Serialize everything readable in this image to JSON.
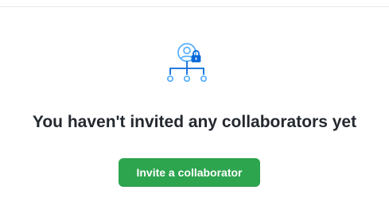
{
  "blankslate": {
    "heading": "You haven't invited any collaborators yet",
    "cta_label": "Invite a collaborator",
    "icon": "person-lock-network-icon"
  },
  "colors": {
    "accent_blue": "#54aeff",
    "accent_blue_dark": "#0969da",
    "button_green": "#2da44e",
    "divider": "#e6e8eb",
    "heading_text": "#24292f"
  }
}
